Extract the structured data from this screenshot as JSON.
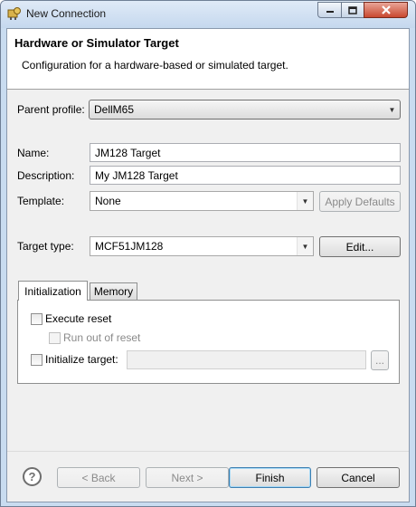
{
  "window": {
    "title": "New Connection",
    "icon": "eclipse-connection-icon"
  },
  "header": {
    "title": "Hardware or Simulator Target",
    "description": "Configuration for a hardware-based or simulated target."
  },
  "form": {
    "parent_profile": {
      "label": "Parent profile:",
      "value": "DellM65"
    },
    "name": {
      "label": "Name:",
      "value": "JM128 Target"
    },
    "description": {
      "label": "Description:",
      "value": "My JM128 Target"
    },
    "template": {
      "label": "Template:",
      "value": "None",
      "apply_label": "Apply Defaults"
    },
    "target_type": {
      "label": "Target type:",
      "value": "MCF51JM128",
      "edit_label": "Edit..."
    }
  },
  "tabs": [
    {
      "label": "Initialization",
      "active": true
    },
    {
      "label": "Memory",
      "active": false
    }
  ],
  "initialization": {
    "execute_reset": {
      "label": "Execute reset",
      "checked": false
    },
    "run_out_of_reset": {
      "label": "Run out of reset",
      "checked": false,
      "enabled": false
    },
    "initialize_target": {
      "label": "Initialize target:",
      "checked": false,
      "value": "",
      "browse_label": "..."
    }
  },
  "footer": {
    "back_label": "< Back",
    "next_label": "Next >",
    "finish_label": "Finish",
    "cancel_label": "Cancel"
  }
}
